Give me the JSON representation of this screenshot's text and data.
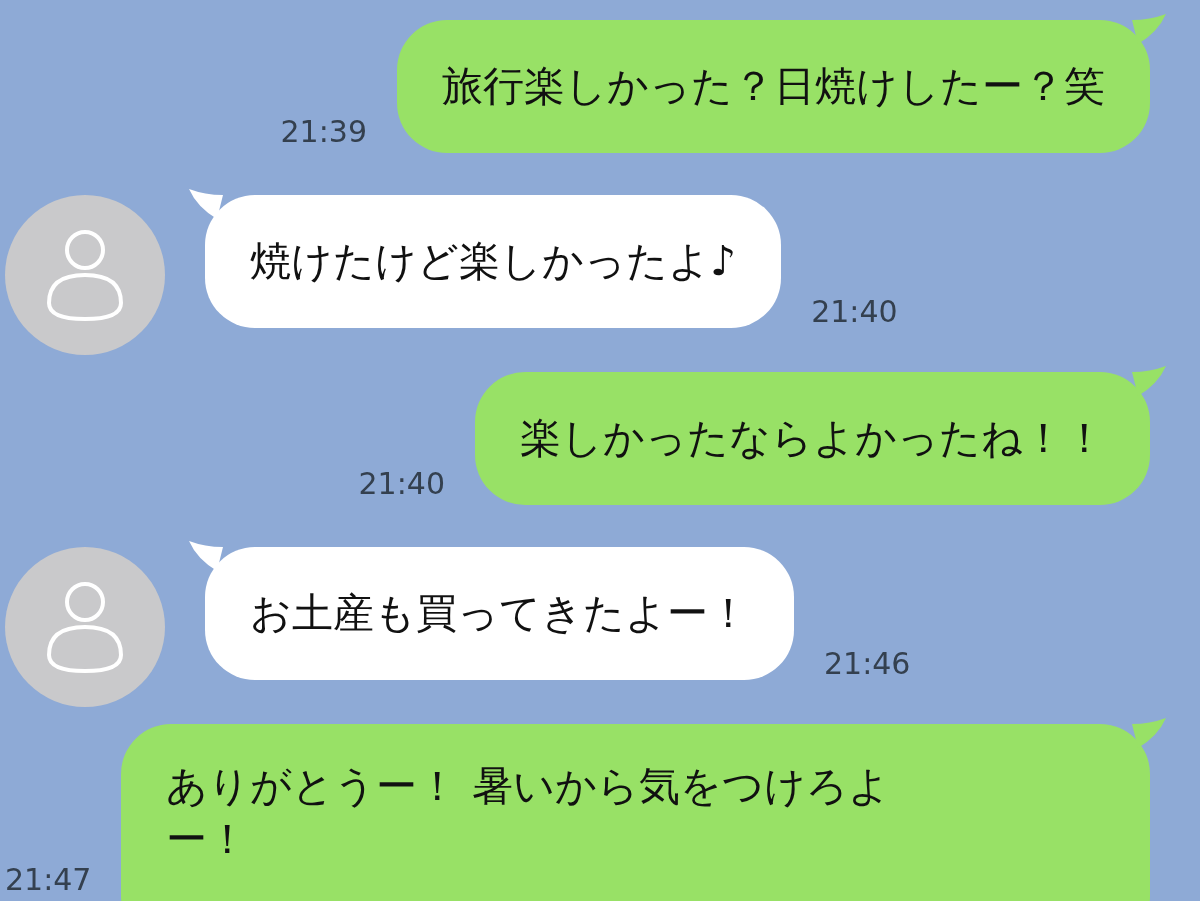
{
  "messages": [
    {
      "kind": "sent",
      "text": "旅行楽しかった？日焼けしたー？笑",
      "time": "21:39"
    },
    {
      "kind": "received",
      "text": "焼けたけど楽しかったよ♪",
      "time": "21:40"
    },
    {
      "kind": "sent",
      "text": "楽しかったならよかったね！！",
      "time": "21:40"
    },
    {
      "kind": "received",
      "text": "お土産も買ってきたよー！",
      "time": "21:46"
    },
    {
      "kind": "sent",
      "text": "ありがとうー！ 暑いから気をつけろよー！",
      "time": "21:47"
    }
  ]
}
